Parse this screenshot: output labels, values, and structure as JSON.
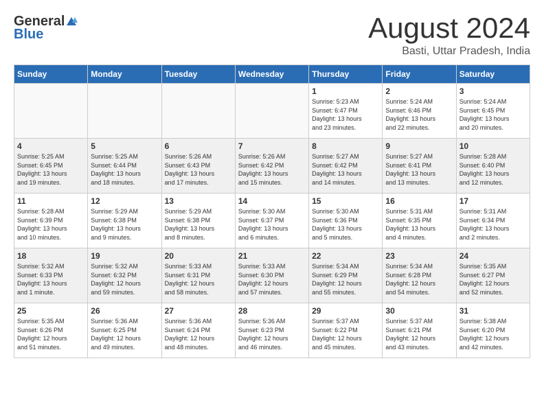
{
  "logo": {
    "general": "General",
    "blue": "Blue"
  },
  "title": "August 2024",
  "location": "Basti, Uttar Pradesh, India",
  "headers": [
    "Sunday",
    "Monday",
    "Tuesday",
    "Wednesday",
    "Thursday",
    "Friday",
    "Saturday"
  ],
  "weeks": [
    [
      {
        "day": "",
        "info": ""
      },
      {
        "day": "",
        "info": ""
      },
      {
        "day": "",
        "info": ""
      },
      {
        "day": "",
        "info": ""
      },
      {
        "day": "1",
        "info": "Sunrise: 5:23 AM\nSunset: 6:47 PM\nDaylight: 13 hours\nand 23 minutes."
      },
      {
        "day": "2",
        "info": "Sunrise: 5:24 AM\nSunset: 6:46 PM\nDaylight: 13 hours\nand 22 minutes."
      },
      {
        "day": "3",
        "info": "Sunrise: 5:24 AM\nSunset: 6:45 PM\nDaylight: 13 hours\nand 20 minutes."
      }
    ],
    [
      {
        "day": "4",
        "info": "Sunrise: 5:25 AM\nSunset: 6:45 PM\nDaylight: 13 hours\nand 19 minutes."
      },
      {
        "day": "5",
        "info": "Sunrise: 5:25 AM\nSunset: 6:44 PM\nDaylight: 13 hours\nand 18 minutes."
      },
      {
        "day": "6",
        "info": "Sunrise: 5:26 AM\nSunset: 6:43 PM\nDaylight: 13 hours\nand 17 minutes."
      },
      {
        "day": "7",
        "info": "Sunrise: 5:26 AM\nSunset: 6:42 PM\nDaylight: 13 hours\nand 15 minutes."
      },
      {
        "day": "8",
        "info": "Sunrise: 5:27 AM\nSunset: 6:42 PM\nDaylight: 13 hours\nand 14 minutes."
      },
      {
        "day": "9",
        "info": "Sunrise: 5:27 AM\nSunset: 6:41 PM\nDaylight: 13 hours\nand 13 minutes."
      },
      {
        "day": "10",
        "info": "Sunrise: 5:28 AM\nSunset: 6:40 PM\nDaylight: 13 hours\nand 12 minutes."
      }
    ],
    [
      {
        "day": "11",
        "info": "Sunrise: 5:28 AM\nSunset: 6:39 PM\nDaylight: 13 hours\nand 10 minutes."
      },
      {
        "day": "12",
        "info": "Sunrise: 5:29 AM\nSunset: 6:38 PM\nDaylight: 13 hours\nand 9 minutes."
      },
      {
        "day": "13",
        "info": "Sunrise: 5:29 AM\nSunset: 6:38 PM\nDaylight: 13 hours\nand 8 minutes."
      },
      {
        "day": "14",
        "info": "Sunrise: 5:30 AM\nSunset: 6:37 PM\nDaylight: 13 hours\nand 6 minutes."
      },
      {
        "day": "15",
        "info": "Sunrise: 5:30 AM\nSunset: 6:36 PM\nDaylight: 13 hours\nand 5 minutes."
      },
      {
        "day": "16",
        "info": "Sunrise: 5:31 AM\nSunset: 6:35 PM\nDaylight: 13 hours\nand 4 minutes."
      },
      {
        "day": "17",
        "info": "Sunrise: 5:31 AM\nSunset: 6:34 PM\nDaylight: 13 hours\nand 2 minutes."
      }
    ],
    [
      {
        "day": "18",
        "info": "Sunrise: 5:32 AM\nSunset: 6:33 PM\nDaylight: 13 hours\nand 1 minute."
      },
      {
        "day": "19",
        "info": "Sunrise: 5:32 AM\nSunset: 6:32 PM\nDaylight: 12 hours\nand 59 minutes."
      },
      {
        "day": "20",
        "info": "Sunrise: 5:33 AM\nSunset: 6:31 PM\nDaylight: 12 hours\nand 58 minutes."
      },
      {
        "day": "21",
        "info": "Sunrise: 5:33 AM\nSunset: 6:30 PM\nDaylight: 12 hours\nand 57 minutes."
      },
      {
        "day": "22",
        "info": "Sunrise: 5:34 AM\nSunset: 6:29 PM\nDaylight: 12 hours\nand 55 minutes."
      },
      {
        "day": "23",
        "info": "Sunrise: 5:34 AM\nSunset: 6:28 PM\nDaylight: 12 hours\nand 54 minutes."
      },
      {
        "day": "24",
        "info": "Sunrise: 5:35 AM\nSunset: 6:27 PM\nDaylight: 12 hours\nand 52 minutes."
      }
    ],
    [
      {
        "day": "25",
        "info": "Sunrise: 5:35 AM\nSunset: 6:26 PM\nDaylight: 12 hours\nand 51 minutes."
      },
      {
        "day": "26",
        "info": "Sunrise: 5:36 AM\nSunset: 6:25 PM\nDaylight: 12 hours\nand 49 minutes."
      },
      {
        "day": "27",
        "info": "Sunrise: 5:36 AM\nSunset: 6:24 PM\nDaylight: 12 hours\nand 48 minutes."
      },
      {
        "day": "28",
        "info": "Sunrise: 5:36 AM\nSunset: 6:23 PM\nDaylight: 12 hours\nand 46 minutes."
      },
      {
        "day": "29",
        "info": "Sunrise: 5:37 AM\nSunset: 6:22 PM\nDaylight: 12 hours\nand 45 minutes."
      },
      {
        "day": "30",
        "info": "Sunrise: 5:37 AM\nSunset: 6:21 PM\nDaylight: 12 hours\nand 43 minutes."
      },
      {
        "day": "31",
        "info": "Sunrise: 5:38 AM\nSunset: 6:20 PM\nDaylight: 12 hours\nand 42 minutes."
      }
    ]
  ]
}
